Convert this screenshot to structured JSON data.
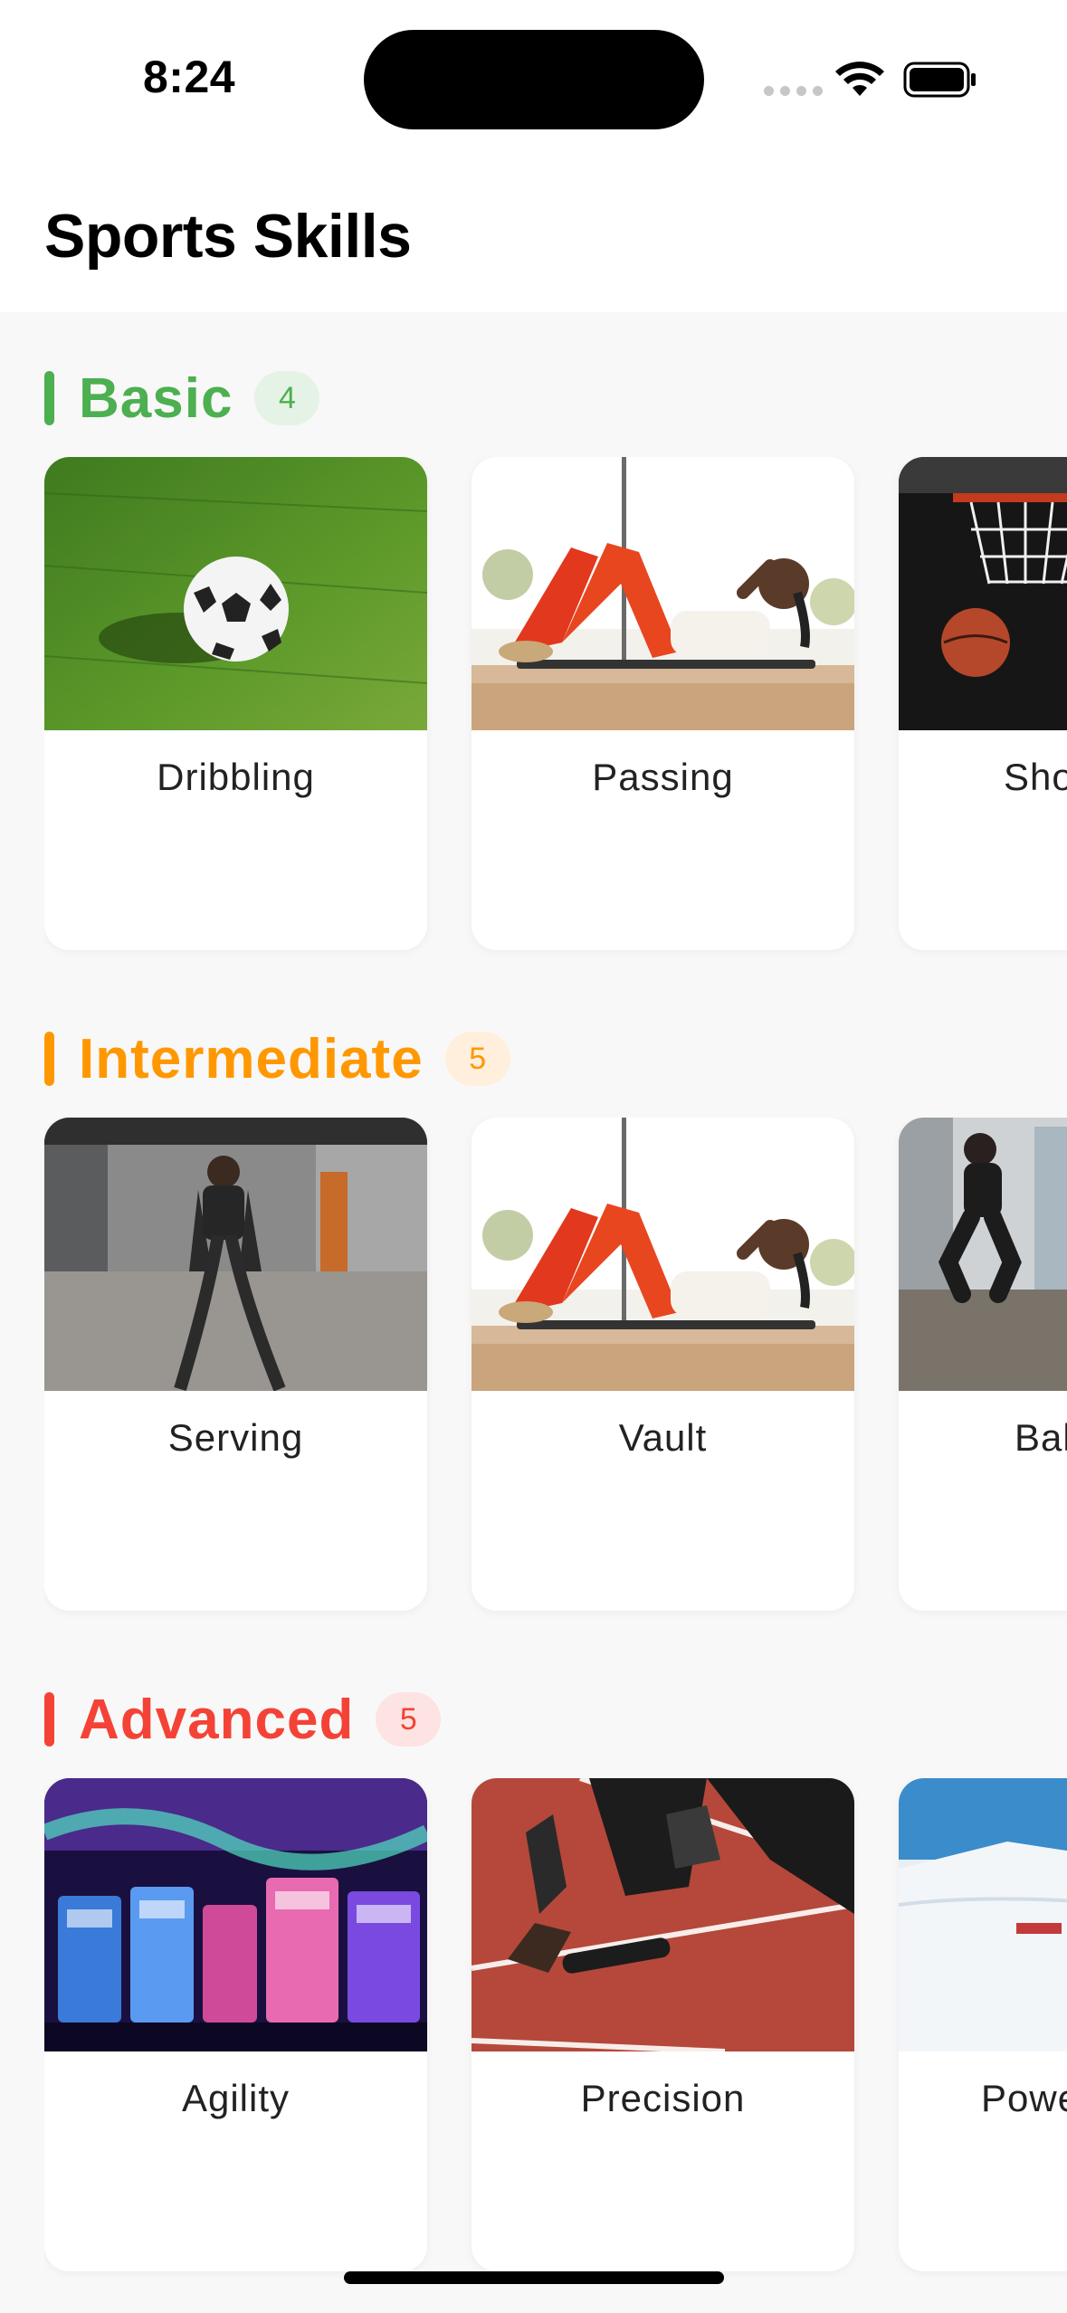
{
  "status_bar": {
    "time": "8:24"
  },
  "header": {
    "title": "Sports Skills"
  },
  "sections": [
    {
      "title": "Basic",
      "count": "4",
      "color": "#4caf50",
      "badge_bg": "#e4f3e5",
      "cards": [
        {
          "label": "Dribbling",
          "image": "soccer-ball-on-grass"
        },
        {
          "label": "Passing",
          "image": "woman-doing-crunches"
        },
        {
          "label": "Sho",
          "image": "basketball-hoop"
        }
      ]
    },
    {
      "title": "Intermediate",
      "count": "5",
      "color": "#ff9800",
      "badge_bg": "#ffefdc",
      "cards": [
        {
          "label": "Serving",
          "image": "battle-ropes-athlete"
        },
        {
          "label": "Vault",
          "image": "woman-doing-crunches"
        },
        {
          "label": "Bal",
          "image": "box-jump-athlete"
        }
      ]
    },
    {
      "title": "Advanced",
      "count": "5",
      "color": "#f44336",
      "badge_bg": "#fde3e1",
      "cards": [
        {
          "label": "Agility",
          "image": "neon-arcade"
        },
        {
          "label": "Precision",
          "image": "sprinter-on-track"
        },
        {
          "label": "Powe",
          "image": "snowy-mountain"
        }
      ]
    }
  ]
}
